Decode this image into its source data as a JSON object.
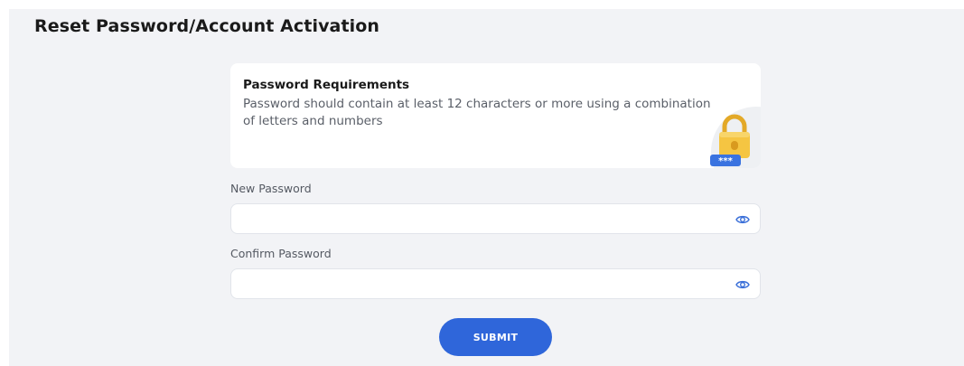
{
  "page": {
    "title": "Reset Password/Account Activation"
  },
  "requirements": {
    "title": "Password Requirements",
    "text": "Password should contain at least 12 characters or more using a combination of letters and numbers",
    "icon": "lock-icon",
    "badge_text": "***"
  },
  "fields": {
    "new_password": {
      "label": "New Password",
      "value": "",
      "placeholder": "",
      "icon": "eye-icon"
    },
    "confirm_password": {
      "label": "Confirm Password",
      "value": "",
      "placeholder": "",
      "icon": "eye-icon"
    }
  },
  "submit": {
    "label": "SUBMIT"
  },
  "colors": {
    "accent": "#2f66da",
    "lock": "#f5c542",
    "background": "#f2f3f6"
  }
}
